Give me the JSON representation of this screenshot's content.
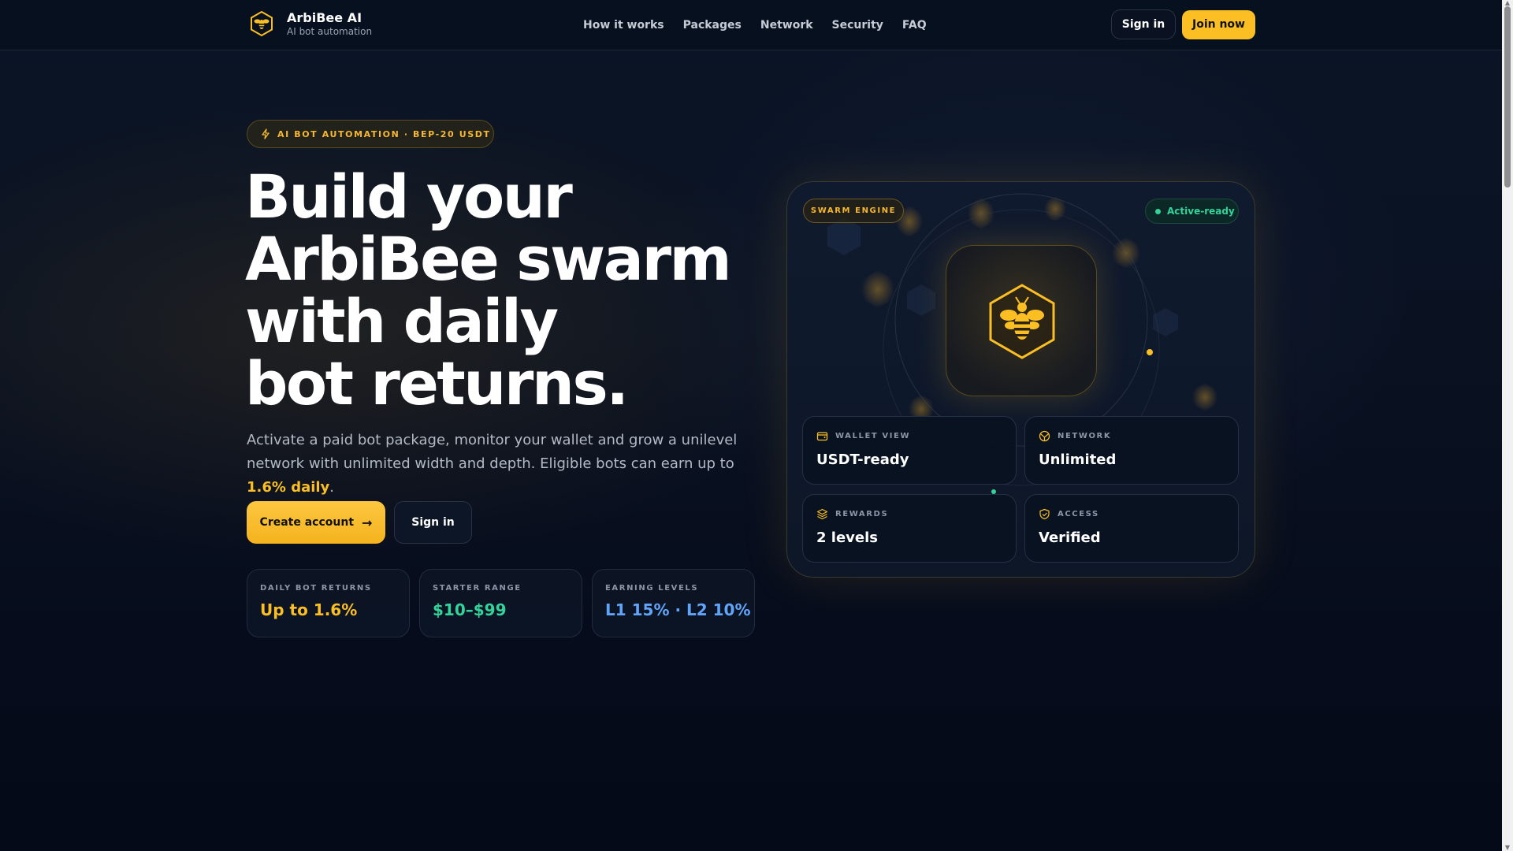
{
  "header": {
    "brand_name": "ArbiBee AI",
    "brand_sub": "AI bot automation",
    "nav": [
      "How it works",
      "Packages",
      "Network",
      "Security",
      "FAQ"
    ],
    "signin_label": "Sign in",
    "join_label": "Join now"
  },
  "hero": {
    "pill_label": "AI BOT AUTOMATION · BEP-20 USDT",
    "headline_lines": [
      "Build your",
      "ArbiBee swarm",
      "with daily",
      "bot returns."
    ],
    "lead_text": "Activate a paid bot package, monitor your wallet and grow a unilevel network with unlimited width and depth. Eligible bots can earn up to ",
    "lead_highlight": "1.6% daily",
    "lead_end": ".",
    "create_label": "Create account",
    "signin_label": "Sign in",
    "stats": [
      {
        "label": "DAILY BOT RETURNS",
        "value": "Up to 1.6%",
        "color": "#fbbf24"
      },
      {
        "label": "STARTER RANGE",
        "value": "$10–$99",
        "color": "#34d399"
      },
      {
        "label": "EARNING LEVELS",
        "value": "L1 15% · L2 10%",
        "color": "#60a5fa"
      }
    ]
  },
  "card": {
    "tag": "SWARM ENGINE",
    "status": "Active-ready",
    "tiles": [
      {
        "icon": "wallet-icon",
        "label": "WALLET VIEW",
        "value": "USDT-ready"
      },
      {
        "icon": "network-icon",
        "label": "NETWORK",
        "value": "Unlimited"
      },
      {
        "icon": "layers-icon",
        "label": "REWARDS",
        "value": "2 levels"
      },
      {
        "icon": "shield-icon",
        "label": "ACCESS",
        "value": "Verified"
      }
    ]
  },
  "colors": {
    "accent": "#fbbf24",
    "success": "#34d399",
    "info": "#60a5fa",
    "background": "#060c1c"
  }
}
